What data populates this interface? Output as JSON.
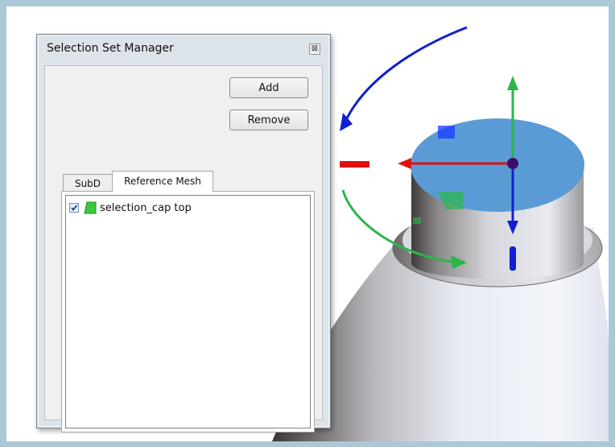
{
  "dialog": {
    "title": "Selection Set Manager",
    "close_glyph": "⊠"
  },
  "buttons": {
    "add_label": "Add",
    "remove_label": "Remove"
  },
  "tabs": [
    {
      "label": "SubD",
      "active": false
    },
    {
      "label": "Reference Mesh",
      "active": true
    }
  ],
  "selection_list": [
    {
      "label": "selection_cap top",
      "checked": true,
      "icon": "green-mesh-swatch-icon"
    }
  ],
  "colors": {
    "gizmo_x": "#e01010",
    "gizmo_y": "#2bb64b",
    "gizmo_z": "#1020d0",
    "cap_top": "#5b9bd5",
    "swatch": "#3ec83e"
  }
}
